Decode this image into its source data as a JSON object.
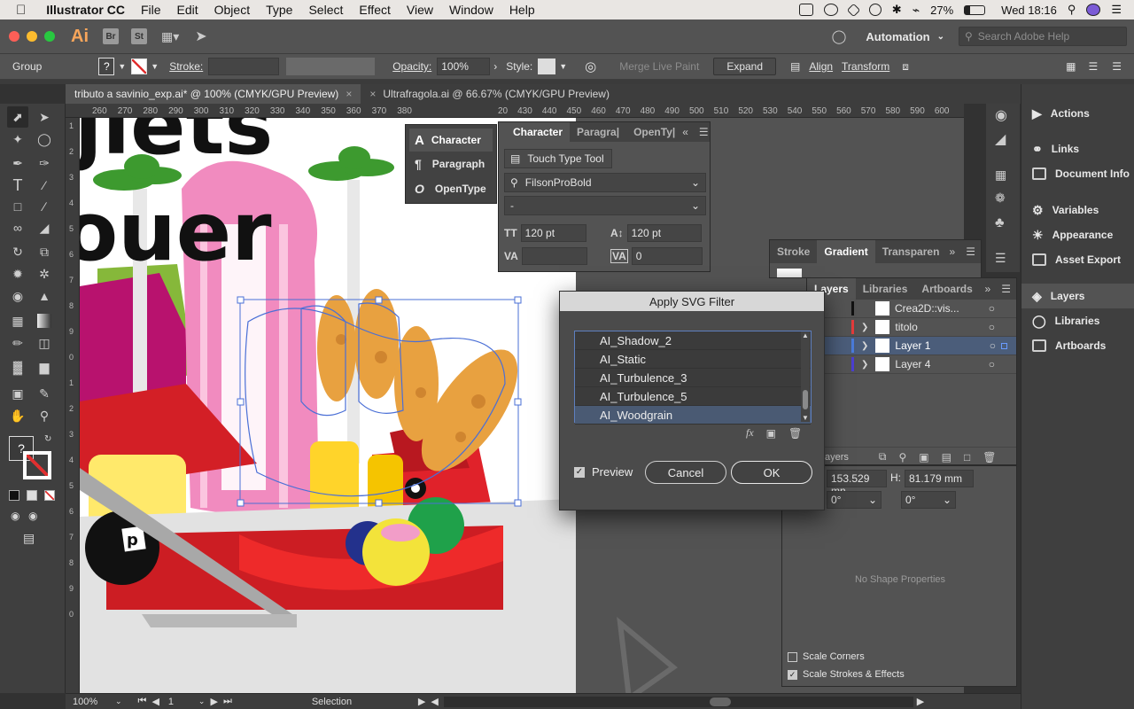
{
  "menubar": {
    "app": "Illustrator CC",
    "items": [
      "File",
      "Edit",
      "Object",
      "Type",
      "Select",
      "Effect",
      "View",
      "Window",
      "Help"
    ],
    "battery": "27%",
    "clock": "Wed 18:16"
  },
  "appbar": {
    "logo": "Ai",
    "bridge": "Br",
    "stock": "St",
    "workspace": "Automation",
    "search_placeholder": "Search Adobe Help"
  },
  "control": {
    "selection_label": "Group",
    "fill_value": "?",
    "stroke_label": "Stroke:",
    "opacity_label": "Opacity:",
    "opacity_value": "100%",
    "style_label": "Style:",
    "merge_live_paint": "Merge Live Paint",
    "expand": "Expand",
    "align": "Align",
    "transform": "Transform"
  },
  "tabs": [
    {
      "label": "tributo a savinio_exp.ai* @ 100% (CMYK/GPU Preview)"
    },
    {
      "label": "Ultrafragola.ai @ 66.67% (CMYK/GPU Preview)"
    }
  ],
  "ruler": {
    "left_ticks": [
      "260",
      "270",
      "280",
      "290",
      "300",
      "310",
      "320",
      "330",
      "340",
      "350",
      "360",
      "370",
      "380"
    ],
    "right_ticks": [
      "20",
      "430",
      "440",
      "450",
      "460",
      "470",
      "480",
      "490",
      "500",
      "510",
      "520",
      "530",
      "540",
      "550",
      "560",
      "570",
      "580",
      "590",
      "600"
    ],
    "vertical_ticks": [
      "1",
      "2",
      "3",
      "4",
      "5",
      "6",
      "7",
      "8",
      "9",
      "0",
      "1",
      "2",
      "3",
      "4",
      "5",
      "6",
      "7",
      "8",
      "9",
      "0"
    ]
  },
  "artwork": {
    "headline_1": "jiets",
    "headline_2": "ouer",
    "ball_letter": "p"
  },
  "char_popup": {
    "items": [
      "Character",
      "Paragraph",
      "OpenType"
    ]
  },
  "char_panel": {
    "tabs": [
      "Character",
      "Paragra|",
      "OpenTy|"
    ],
    "touch_type": "Touch Type Tool",
    "font": "FilsonProBold",
    "style": "-",
    "size": "120 pt",
    "leading": "120 pt",
    "tracking": "0"
  },
  "gradient_panel": {
    "tabs": [
      "Stroke",
      "Gradient",
      "Transparen"
    ]
  },
  "layers_panel": {
    "tabs": [
      "Layers",
      "Libraries",
      "Artboards"
    ],
    "rows": [
      {
        "name": "Crea2D::vis...",
        "color": "#2a2a2a"
      },
      {
        "name": "titolo",
        "color": "#e23b3b"
      },
      {
        "name": "Layer 1",
        "color": "#4a7bd9"
      },
      {
        "name": "Layer 4",
        "color": "#4b3fd0"
      }
    ],
    "footer_label": "ayers"
  },
  "transform_panel": {
    "w": "153.529 mn",
    "h_label": "H:",
    "h": "81.179 mm",
    "angle1": "0°",
    "angle2": "0°",
    "no_shape": "No Shape Properties",
    "scale_corners": "Scale Corners",
    "scale_strokes": "Scale Strokes & Effects"
  },
  "dock": {
    "group1": [
      "Actions"
    ],
    "group2": [
      "Links",
      "Document Info"
    ],
    "group3": [
      "Variables",
      "Appearance",
      "Asset Export"
    ],
    "group4": [
      "Layers",
      "Libraries",
      "Artboards"
    ]
  },
  "dialog": {
    "title": "Apply SVG Filter",
    "filters": [
      "AI_Shadow_2",
      "AI_Static",
      "AI_Turbulence_3",
      "AI_Turbulence_5",
      "AI_Woodgrain"
    ],
    "selected": "AI_Woodgrain",
    "fx_label": "fx",
    "preview_label": "Preview",
    "cancel": "Cancel",
    "ok": "OK"
  },
  "status": {
    "zoom": "100%",
    "artboard": "1",
    "tool": "Selection"
  }
}
